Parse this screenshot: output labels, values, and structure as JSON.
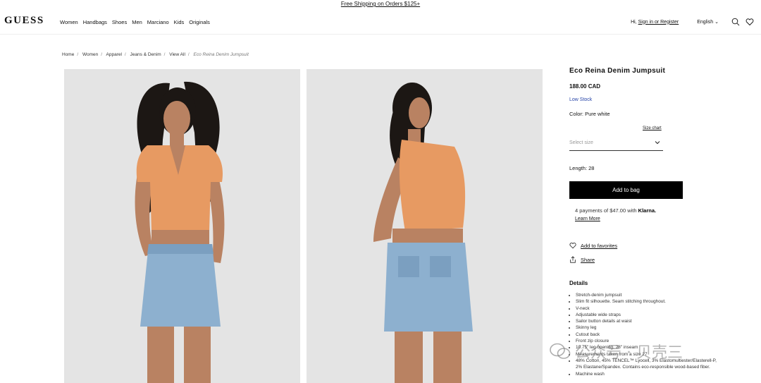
{
  "promo": "Free Shipping on Orders $125+",
  "brand": "GUESS",
  "nav": [
    "Women",
    "Handbags",
    "Shoes",
    "Men",
    "Marciano",
    "Kids",
    "Originals"
  ],
  "header": {
    "greeting": "Hi,",
    "signin": "Sign in or Register",
    "language": "English"
  },
  "breadcrumb": [
    "Home",
    "Women",
    "Apparel",
    "Jeans & Denim",
    "View All",
    "Eco Reina Denim Jumpsuit"
  ],
  "product": {
    "title": "Eco Reina Denim Jumpsuit",
    "price": "188.00 CAD",
    "stock": "Low Stock",
    "color": "Color: Pure white",
    "size_chart": "Size chart",
    "size_placeholder": "Select size",
    "length": "Length: 28",
    "add_to_bag": "Add to bag",
    "klarna_text": "4 payments of $47.00 with",
    "klarna_brand": "Klarna.",
    "learn_more": "Learn More",
    "favorites": "Add to favorites",
    "share": "Share",
    "details_heading": "Details",
    "details": [
      "Stretch-denim jumpsuit",
      "Slim fit silhouette. Seam stitching throughout.",
      "V-neck",
      "Adjustable wide straps",
      "Sailor button details at waist",
      "Skinny leg",
      "Cutout back",
      "Front zip closure",
      "10.75\" leg opening, 28\" inseam",
      "Measurements taken from a size 27",
      "48% Cotton, 45% TENCEL™ Lyocell, 3% Elastomultiester/Elasterell-P, 2% Elastane/Spandex. Contains eco-responsible wood-based fiber.",
      "Machine wash"
    ]
  },
  "watermark": "公众号 · 贝壳三",
  "colors": {
    "top": "#e79a62",
    "denim": "#8db0cf",
    "hair": "#1c1714",
    "skin": "#b98262",
    "bg": "#e4e4e4",
    "stock_link": "#2845a8"
  }
}
